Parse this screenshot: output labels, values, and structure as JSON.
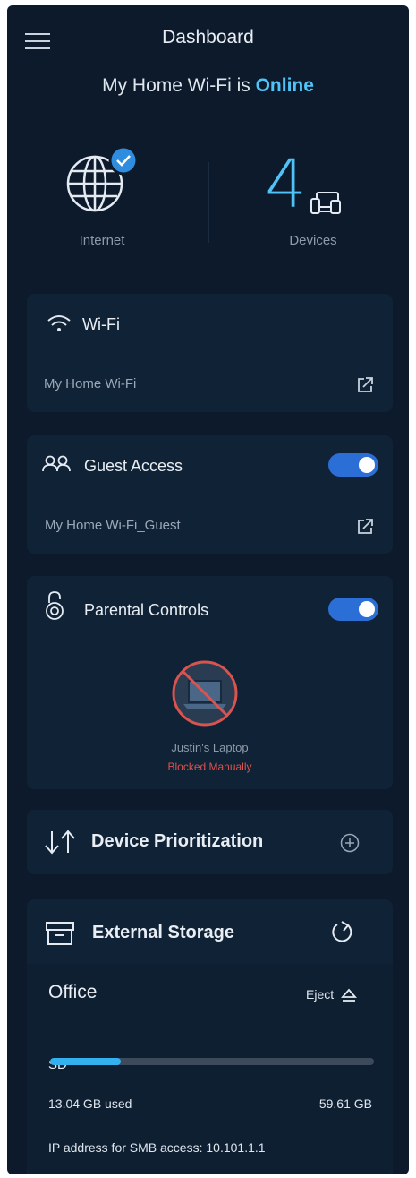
{
  "header": {
    "title": "Dashboard",
    "menu_icon": "hamburger-menu-icon"
  },
  "status": {
    "prefix": "My Home Wi-Fi is",
    "state": "Online",
    "state_color": "#4fc3f7"
  },
  "stats": {
    "internet_label": "Internet",
    "internet_icon": "globe-check-icon",
    "devices_count": "4",
    "devices_label": "Devices",
    "devices_icon": "devices-icon"
  },
  "wifi": {
    "title": "Wi-Fi",
    "icon": "wifi-icon",
    "network_name": "My Home Wi-Fi"
  },
  "guest": {
    "title": "Guest Access",
    "icon": "guest-users-icon",
    "network_name": "My Home Wi-Fi_Guest",
    "enabled": true
  },
  "parental": {
    "title": "Parental Controls",
    "icon": "lock-icon",
    "enabled": true,
    "device_name": "Justin's Laptop",
    "device_status": "Blocked Manually",
    "device_icon": "blocked-laptop-icon"
  },
  "prioritization": {
    "title": "Device Prioritization",
    "icon": "up-down-arrows-icon",
    "add_icon": "plus-circle-icon"
  },
  "storage": {
    "title": "External Storage",
    "icon": "storage-drive-icon",
    "refresh_icon": "refresh-icon",
    "drive_name": "Office",
    "eject_label": "Eject",
    "eject_icon": "eject-icon",
    "volume": "SD",
    "used": "13.04 GB used",
    "total": "59.61 GB",
    "used_fraction": 0.219,
    "ip_text": "IP address for SMB access: 10.101.1.1"
  },
  "colors": {
    "background": "#0c1a2b",
    "card": "#102236",
    "accent": "#4fc3f7",
    "toggle_on": "#2b6fd6",
    "blocked_red": "#d9534f"
  }
}
